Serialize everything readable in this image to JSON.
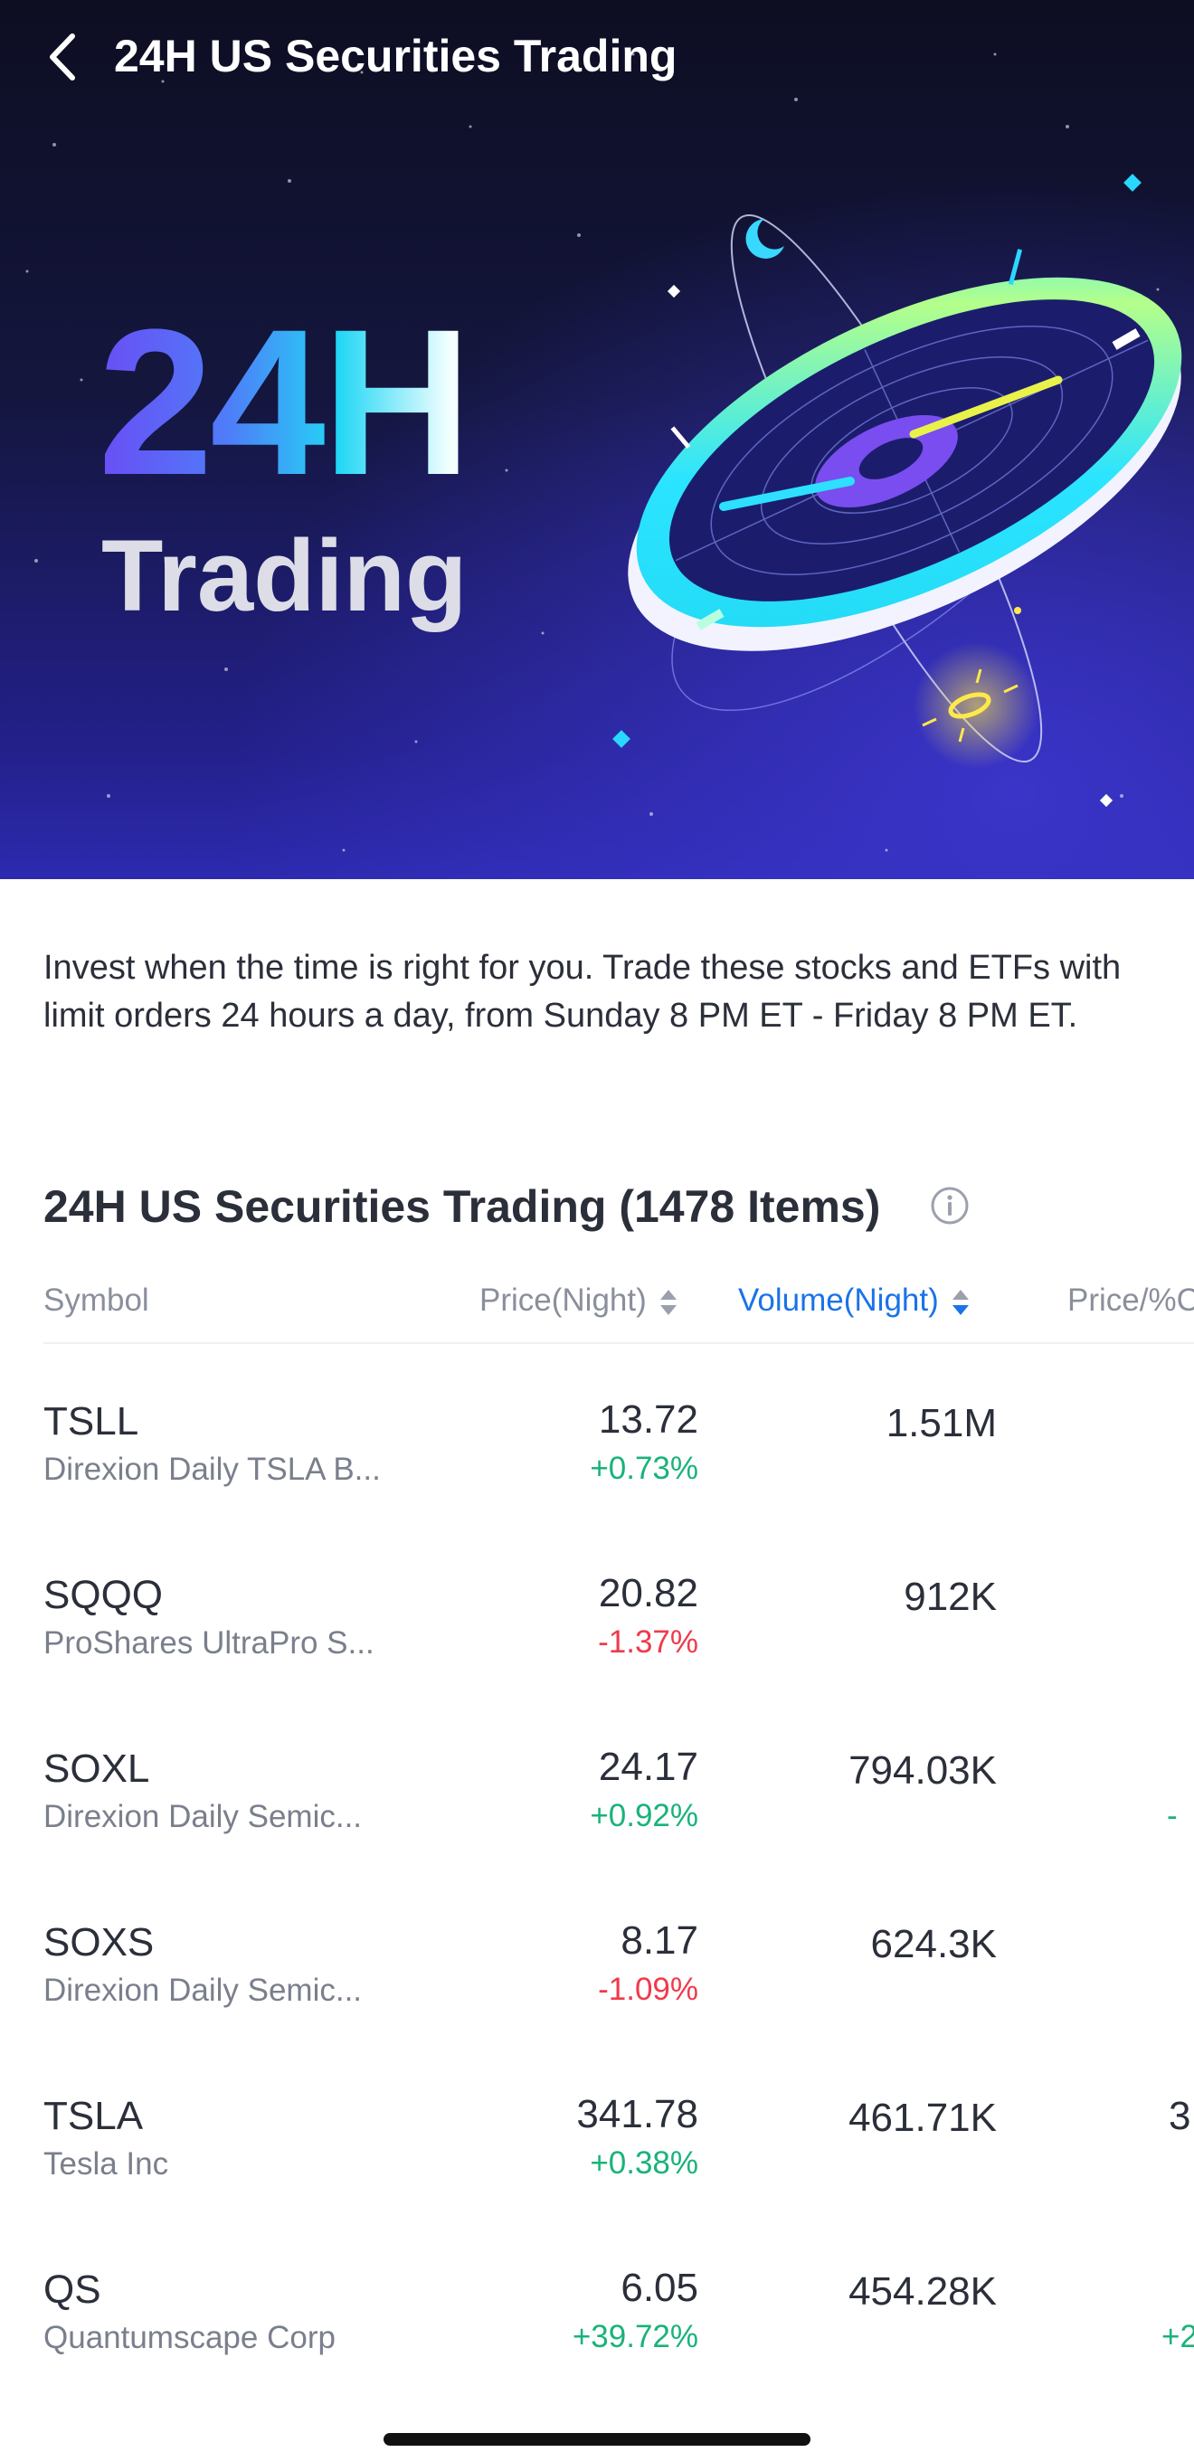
{
  "header": {
    "title": "24H US Securities Trading",
    "back_icon": "chevron-left-icon"
  },
  "hero": {
    "big_text": "24H",
    "sub_text": "Trading"
  },
  "intro_text": "Invest when the time is right for you. Trade these stocks and ETFs with limit orders 24 hours a day, from Sunday 8 PM ET - Friday 8 PM ET.",
  "section": {
    "title": "24H US Securities Trading (1478 Items)",
    "info_icon": "info-icon"
  },
  "columns": {
    "symbol": "Symbol",
    "price": "Price(Night)",
    "volume": "Volume(Night)",
    "change": "Price/%C"
  },
  "colors": {
    "accent": "#1a73e8",
    "up": "#19b37a",
    "down": "#f03a4b"
  },
  "rows": [
    {
      "symbol": "TSLL",
      "name": "Direxion Daily TSLA B...",
      "price": "13.72",
      "change": "+0.73%",
      "direction": "up",
      "volume": "1.51M",
      "extra": "",
      "extra_pct": ""
    },
    {
      "symbol": "SQQQ",
      "name": "ProShares UltraPro S...",
      "price": "20.82",
      "change": "-1.37%",
      "direction": "down",
      "volume": "912K",
      "extra": "",
      "extra_pct": ""
    },
    {
      "symbol": "SOXL",
      "name": "Direxion Daily Semic...",
      "price": "24.17",
      "change": "+0.92%",
      "direction": "up",
      "volume": "794.03K",
      "extra": "",
      "extra_pct": "-"
    },
    {
      "symbol": "SOXS",
      "name": "Direxion Daily Semic...",
      "price": "8.17",
      "change": "-1.09%",
      "direction": "down",
      "volume": "624.3K",
      "extra": "",
      "extra_pct": ""
    },
    {
      "symbol": "TSLA",
      "name": "Tesla Inc",
      "price": "341.78",
      "change": "+0.38%",
      "direction": "up",
      "volume": "461.71K",
      "extra": "3",
      "extra_pct": ""
    },
    {
      "symbol": "QS",
      "name": "Quantumscape Corp",
      "price": "6.05",
      "change": "+39.72%",
      "direction": "up",
      "volume": "454.28K",
      "extra": "",
      "extra_pct": "+2"
    }
  ]
}
